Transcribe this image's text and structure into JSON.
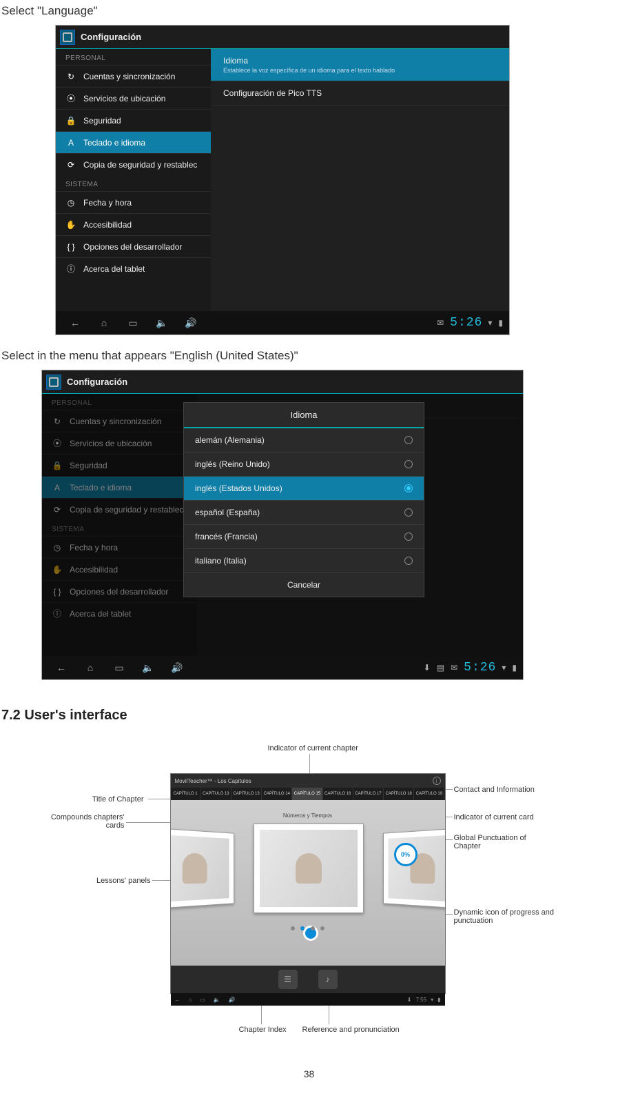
{
  "instructions": {
    "step1": "Select \"Language\"",
    "step2": "Select in the menu that appears \"English (United States)\""
  },
  "heading": "7.2 User's interface",
  "page_number": "38",
  "screen1": {
    "title": "Configuración",
    "sections": {
      "personal": "PERSONAL",
      "sistema": "SISTEMA"
    },
    "menu": {
      "cuentas": "Cuentas y sincronización",
      "servicios": "Servicios de ubicación",
      "seguridad": "Seguridad",
      "teclado": "Teclado e idioma",
      "copia": "Copia de seguridad y restablec",
      "fecha": "Fecha y hora",
      "acces": "Accesibilidad",
      "dev": "Opciones del desarrollador",
      "acerca": "Acerca del tablet"
    },
    "main": {
      "idioma": "Idioma",
      "idioma_sub": "Establece la voz específica de un idioma para el texto hablado",
      "pico": "Configuración de Pico TTS"
    },
    "clock": "5:26"
  },
  "screen2": {
    "title": "Configuración",
    "dialog_title": "Idioma",
    "main_header": "Idioma",
    "options": {
      "de": "alemán (Alemania)",
      "uk": "inglés (Reino Unido)",
      "us": "inglés (Estados Unidos)",
      "es": "español (España)",
      "fr": "francés (Francia)",
      "it": "italiano (Italia)"
    },
    "cancel": "Cancelar",
    "clock": "5:26"
  },
  "fig3": {
    "app_title": "MovilTeacher™ - Los Capítulos",
    "tabs": [
      "CAPÍTULO 1",
      "CAPÍTULO 13",
      "CAPÍTULO 13",
      "CAPÍTULO 14",
      "CAPÍTULO 15",
      "CAPÍTULO 16",
      "CAPÍTULO 17",
      "CAPÍTULO 18",
      "CAPÍTULO 19"
    ],
    "card_title": "Números y Tiempos",
    "gauge": "0%",
    "callouts": {
      "indicator_chapter": "Indicator of current chapter",
      "title_chapter": "Title of Chapter",
      "compounds": "Compounds chapters' cards",
      "lessons": "Lessons' panels",
      "contact": "Contact and Information",
      "indicator_card": "Indicator of current card",
      "global": "Global Punctuation of Chapter",
      "dynamic": "Dynamic icon of progress and punctuation",
      "chapter_index": "Chapter Index",
      "reference": "Reference and pronunciation"
    },
    "nav_time": "7:55"
  }
}
